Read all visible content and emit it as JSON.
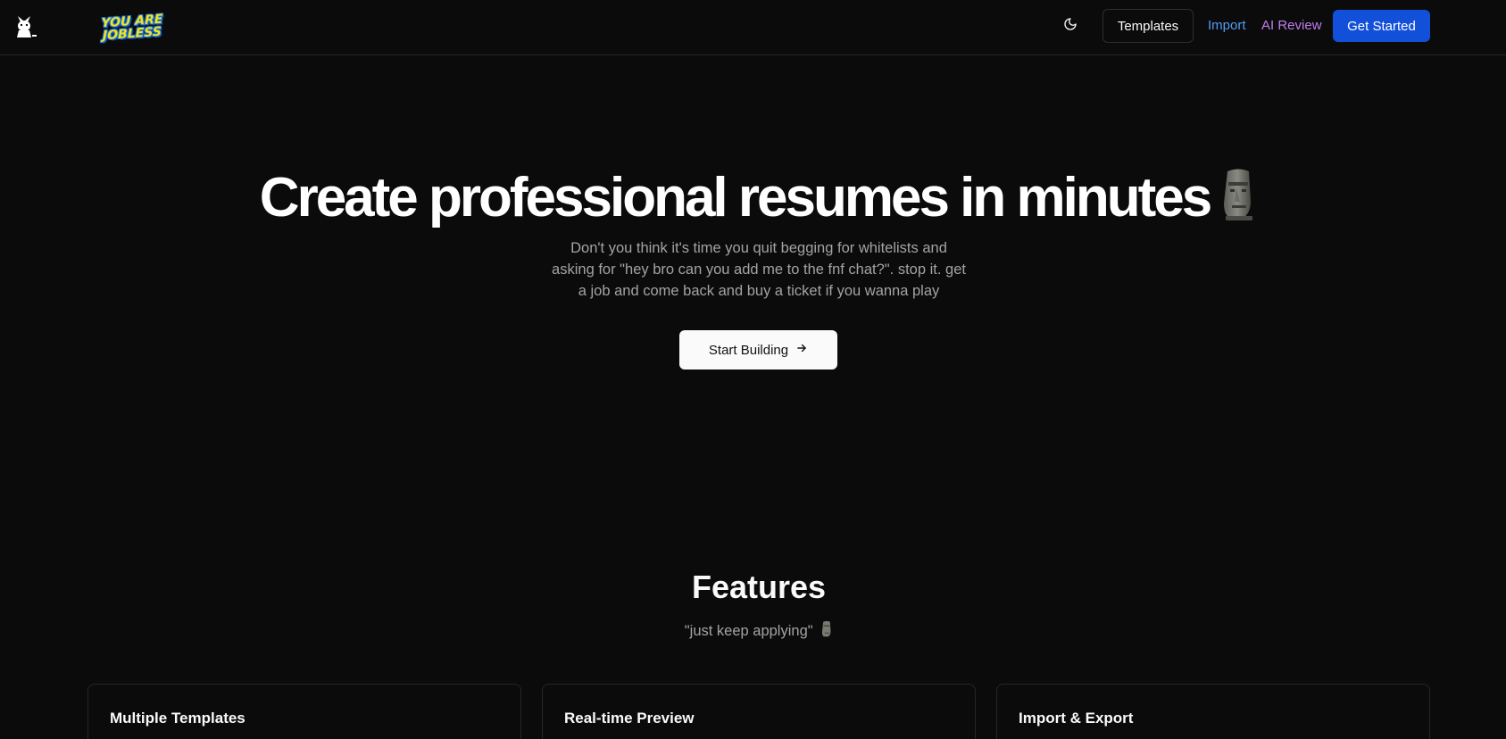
{
  "header": {
    "brand_logo_text": "YOU ARE JOBLESS",
    "theme_toggle_icon": "moon-icon",
    "nav": {
      "templates": "Templates",
      "import": "Import",
      "ai_review": "AI Review",
      "get_started": "Get Started"
    },
    "colors": {
      "import": "#4f9cf5",
      "ai_review": "#c07cf0",
      "get_started_bg": "#1350d9"
    }
  },
  "hero": {
    "title": "Create professional resumes in minutes",
    "title_emoji": "moai-icon",
    "subtitle": "Don't you think it's time you quit begging for whitelists and asking for \"hey bro can you add me to the fnf chat?\". stop it. get a job and come back and buy a ticket if you wanna play",
    "cta": "Start Building",
    "cta_icon": "arrow-right-icon"
  },
  "features": {
    "title": "Features",
    "subtitle": "\"just keep applying\"",
    "subtitle_emoji": "moai-icon",
    "cards": [
      {
        "title": "Multiple Templates"
      },
      {
        "title": "Real-time Preview"
      },
      {
        "title": "Import & Export"
      }
    ]
  }
}
